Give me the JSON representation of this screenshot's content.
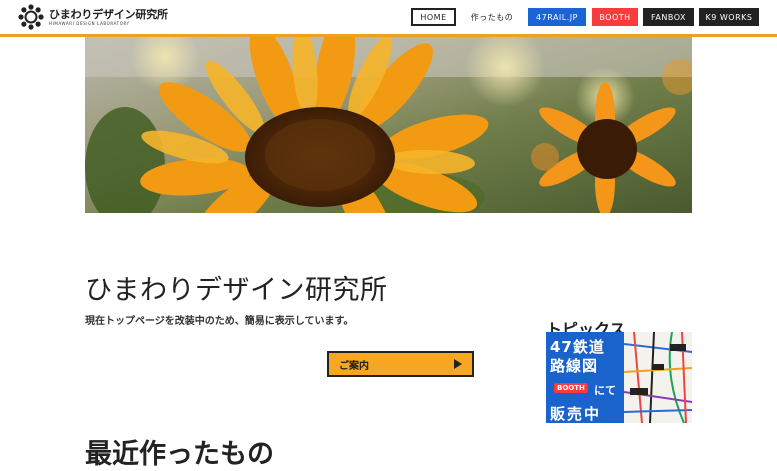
{
  "header": {
    "logo_title": "ひまわりデザイン研究所",
    "logo_sub": "HIMAWARI DESIGN LABORATORY"
  },
  "nav": {
    "home": "HOME",
    "works": "作ったもの",
    "rail47": "47RAIL.JP",
    "booth": "BOOTH",
    "fanbox": "FANBOX",
    "k9": "K9 WORKS"
  },
  "colors": {
    "accent": "#f0a020",
    "rail47": "#1a64d6",
    "booth": "#fc3c3c",
    "dark": "#222222",
    "button": "#f5a623"
  },
  "main": {
    "title": "ひまわりデザイン研究所",
    "notice": "現在トップページを改装中のため、簡易に表示しています。",
    "guide_button": "ご案内",
    "recent_heading": "最近作ったもの"
  },
  "sidebar": {
    "topics_heading": "トピックス",
    "banner": {
      "line1": "47鉄道",
      "line2": "路線図",
      "booth": "BOOTH",
      "suffix": "にて",
      "line3": "販売中"
    }
  },
  "icons": {
    "logo": "sunflower-logo-icon",
    "guide_arrow": "play-arrow-icon"
  }
}
